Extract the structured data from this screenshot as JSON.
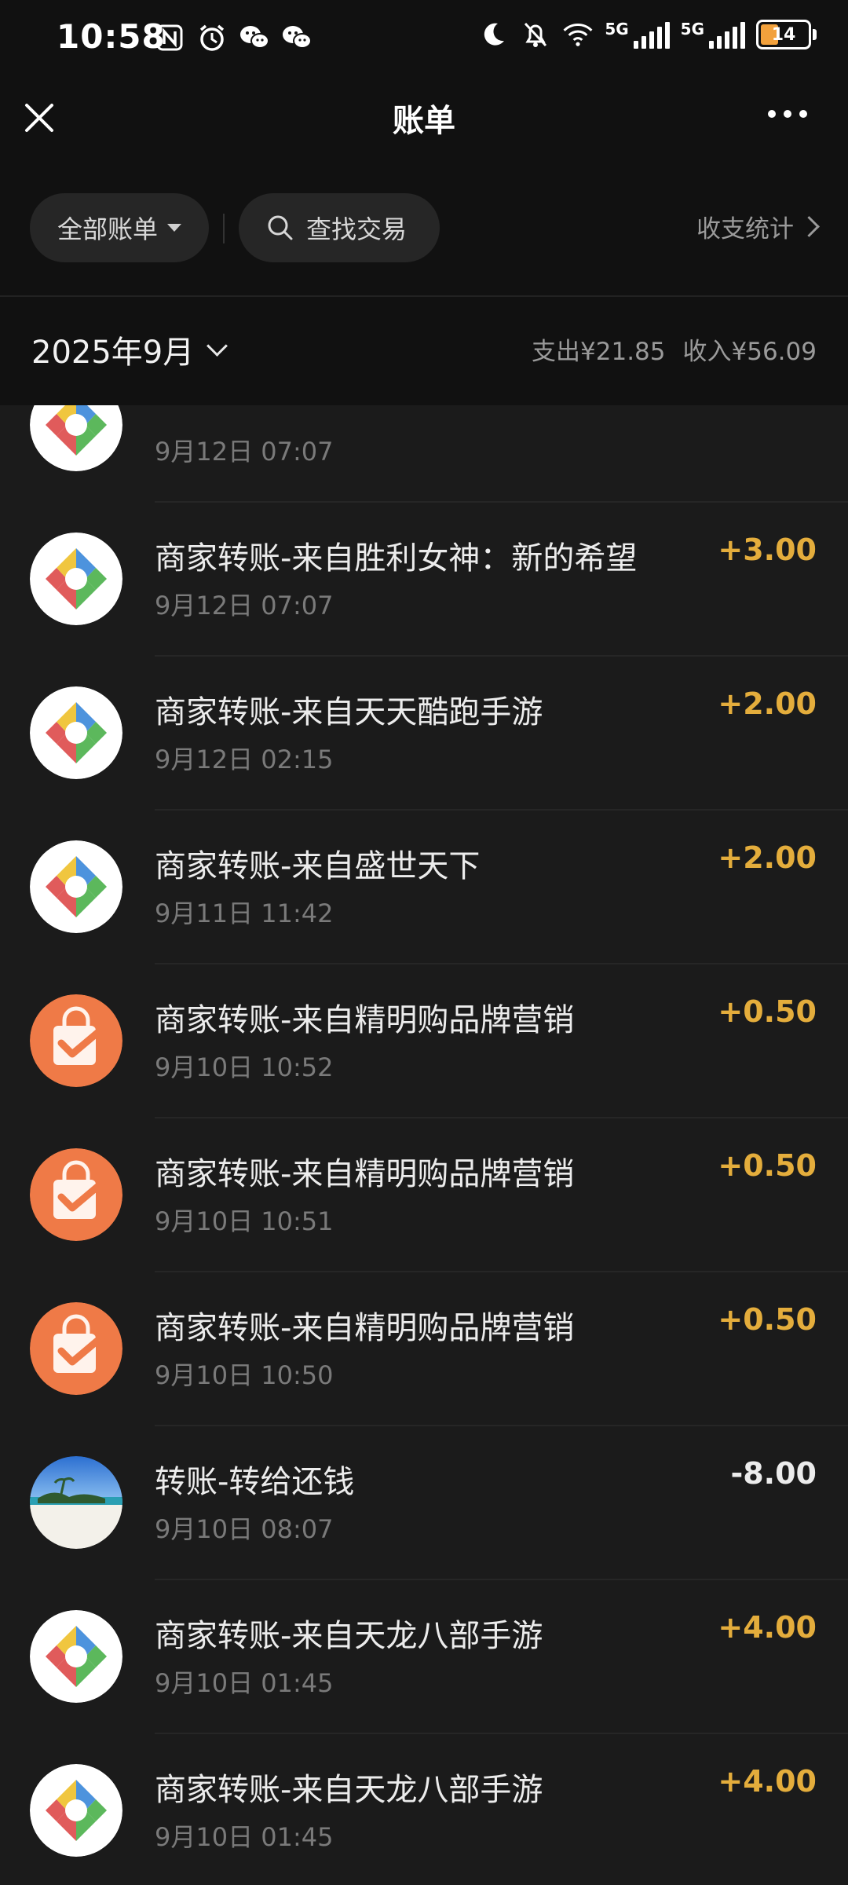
{
  "status_bar": {
    "time": "10:58",
    "left_icons": [
      "nfc-icon",
      "alarm-icon",
      "wechat-icon",
      "wechat-icon"
    ],
    "right_icons": [
      "moon-icon",
      "bell-off-icon",
      "wifi-icon",
      "signal-5g-icon",
      "signal-5g-icon"
    ],
    "network_label_1": "5G",
    "network_label_2": "5G",
    "battery": "14"
  },
  "header": {
    "title": "账单",
    "close_icon": "close-icon",
    "more_icon": "more-icon"
  },
  "filters": {
    "all_bills": "全部账单",
    "search": "查找交易",
    "stats": "收支统计"
  },
  "month_bar": {
    "month": "2025年9月",
    "expense": "支出¥21.85",
    "income": "收入¥56.09"
  },
  "colors": {
    "income": "#e4ad3c",
    "background": "#1b1b1b",
    "header_bg": "#111111"
  },
  "transactions": [
    {
      "title": "",
      "time": "9月12日 07:07",
      "amount": "",
      "avatar": "game-logo-icon"
    },
    {
      "title": "商家转账-来自胜利女神：新的希望",
      "time": "9月12日 07:07",
      "amount": "+3.00",
      "avatar": "game-logo-icon"
    },
    {
      "title": "商家转账-来自天天酷跑手游",
      "time": "9月12日 02:15",
      "amount": "+2.00",
      "avatar": "game-logo-icon"
    },
    {
      "title": "商家转账-来自盛世天下",
      "time": "9月11日 11:42",
      "amount": "+2.00",
      "avatar": "game-logo-icon"
    },
    {
      "title": "商家转账-来自精明购品牌营销",
      "time": "9月10日 10:52",
      "amount": "+0.50",
      "avatar": "shopping-bag-icon"
    },
    {
      "title": "商家转账-来自精明购品牌营销",
      "time": "9月10日 10:51",
      "amount": "+0.50",
      "avatar": "shopping-bag-icon"
    },
    {
      "title": "商家转账-来自精明购品牌营销",
      "time": "9月10日 10:50",
      "amount": "+0.50",
      "avatar": "shopping-bag-icon"
    },
    {
      "title": "转账-转给还钱",
      "time": "9月10日 08:07",
      "amount": "-8.00",
      "avatar": "beach-photo-avatar"
    },
    {
      "title": "商家转账-来自天龙八部手游",
      "time": "9月10日 01:45",
      "amount": "+4.00",
      "avatar": "game-logo-icon"
    },
    {
      "title": "商家转账-来自天龙八部手游",
      "time": "9月10日 01:45",
      "amount": "+4.00",
      "avatar": "game-logo-icon"
    }
  ]
}
